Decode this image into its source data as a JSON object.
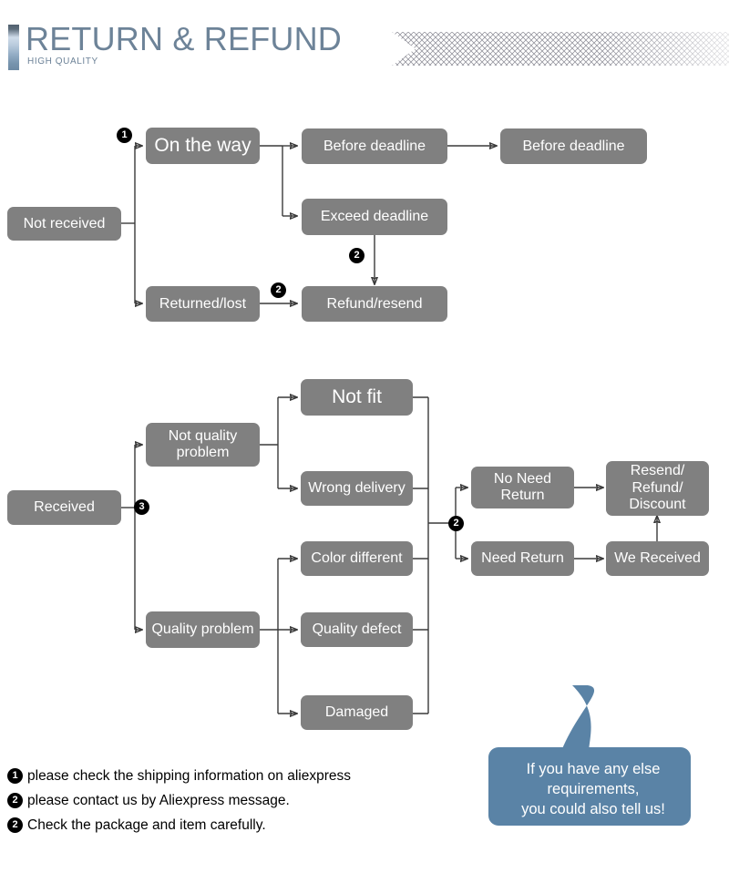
{
  "header": {
    "title": "RETURN & REFUND",
    "subtitle": "HIGH QUALITY",
    "accent_color": "#6d8398",
    "pattern_icon": "crosshatch-banner"
  },
  "flow_not_received": {
    "boxes": {
      "not_received": "Not received",
      "on_the_way": "On the way",
      "before_deadline_1": "Before deadline",
      "before_deadline_2": "Before deadline",
      "exceed_deadline": "Exceed deadline",
      "returned_lost": "Returned/lost",
      "refund_resend": "Refund/resend"
    },
    "badges": {
      "on_the_way": "1",
      "exceed_to_refund": "2",
      "returned_to_refund": "2"
    }
  },
  "flow_received": {
    "boxes": {
      "received": "Received",
      "not_quality_problem": "Not quality\nproblem",
      "quality_problem": "Quality problem",
      "not_fit": "Not fit",
      "wrong_delivery": "Wrong delivery",
      "color_different": "Color different",
      "quality_defect": "Quality defect",
      "damaged": "Damaged",
      "no_need_return": "No Need\nReturn",
      "need_return": "Need Return",
      "we_received": "We Received",
      "resend_refund_discount": "Resend/\nRefund/\nDiscount"
    },
    "badges": {
      "received": "3",
      "return_branch": "2"
    }
  },
  "notes": [
    {
      "badge": "1",
      "text": "please check the shipping information on aliexpress"
    },
    {
      "badge": "2",
      "text": "please contact us by Aliexpress message."
    },
    {
      "badge": "2",
      "text": "Check the package and item carefully."
    }
  ],
  "bubble": {
    "color": "#5a83a6",
    "lines": [
      "If you have any else",
      "requirements,",
      "you could also tell us!"
    ]
  },
  "colors": {
    "box_fill": "#808080",
    "box_text": "#ffffff",
    "connector": "#3a3a3a",
    "badge_fill": "#000000",
    "page_background": "#ffffff"
  }
}
